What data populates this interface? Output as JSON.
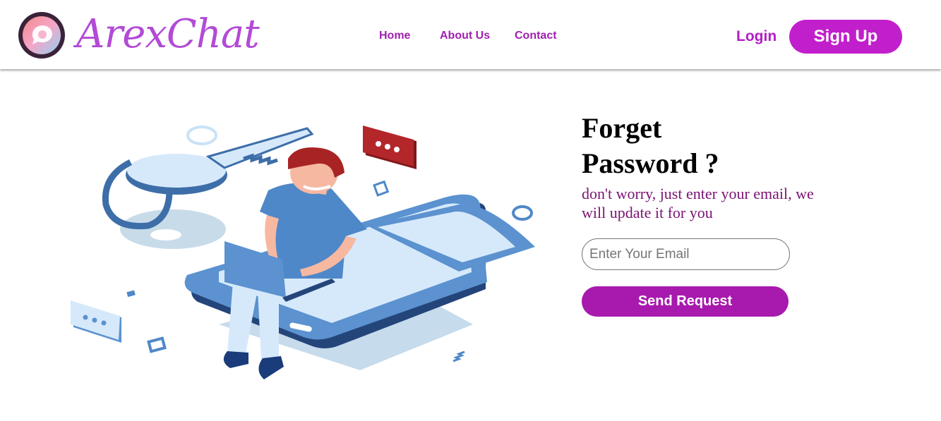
{
  "brand": {
    "name": "ArexChat",
    "logo_icon": "chat-bubble-logo-icon",
    "color": "#b24bd6"
  },
  "nav": {
    "links": [
      {
        "label": "Home"
      },
      {
        "label": "About Us"
      },
      {
        "label": "Contact"
      }
    ],
    "login_label": "Login",
    "signup_label": "Sign Up",
    "accent_color": "#c21fcc"
  },
  "illustration": {
    "icon": "person-with-laptop-on-phone-key-illustration"
  },
  "form": {
    "title_line1": "Forget",
    "title_line2": "Password ?",
    "subtitle": "don't worry, just enter your email, we will update it for you",
    "email_placeholder": "Enter Your Email",
    "email_value": "",
    "submit_label": "Send Request",
    "button_color": "#a71aad"
  }
}
